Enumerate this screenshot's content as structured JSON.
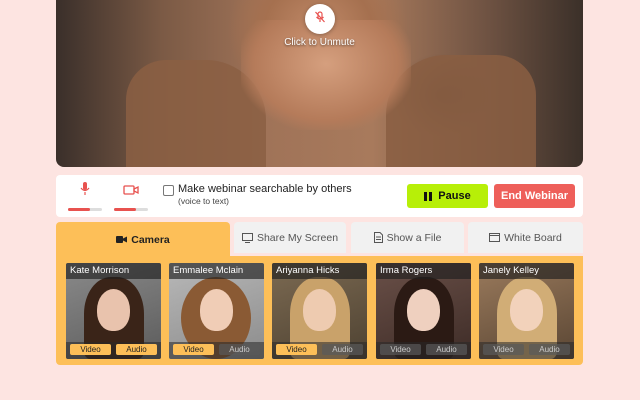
{
  "stage": {
    "unmute_label": "Click to Unmute"
  },
  "controls": {
    "mic_level": 0.65,
    "cam_level": 0.65,
    "searchable_label": "Make webinar searchable by others",
    "searchable_sub": "(voice to text)",
    "searchable_checked": false,
    "pause_label": "Pause",
    "end_label": "End Webinar"
  },
  "tabs": [
    {
      "label": "Camera",
      "icon": "video-icon",
      "active": true
    },
    {
      "label": "Share My Screen",
      "icon": "monitor-icon",
      "active": false
    },
    {
      "label": "Show a File",
      "icon": "file-icon",
      "active": false
    },
    {
      "label": "White Board",
      "icon": "whiteboard-icon",
      "active": false
    }
  ],
  "participants": [
    {
      "name": "Kate Morrison",
      "video": "Video",
      "audio": "Audio",
      "video_on": true,
      "audio_on": true
    },
    {
      "name": "Emmalee Mclain",
      "video": "Video",
      "audio": "Audio",
      "video_on": true,
      "audio_on": false
    },
    {
      "name": "Ariyanna Hicks",
      "video": "Video",
      "audio": "Audio",
      "video_on": true,
      "audio_on": false
    },
    {
      "name": "Irma Rogers",
      "video": "Video",
      "audio": "Audio",
      "video_on": false,
      "audio_on": false
    },
    {
      "name": "Janely Kelley",
      "video": "Video",
      "audio": "Audio",
      "video_on": false,
      "audio_on": false
    }
  ],
  "colors": {
    "accent": "#fdbf58",
    "pause": "#b7ef08",
    "end": "#ee5f5a",
    "indicator": "#e8524f",
    "background": "#fde4e1"
  }
}
